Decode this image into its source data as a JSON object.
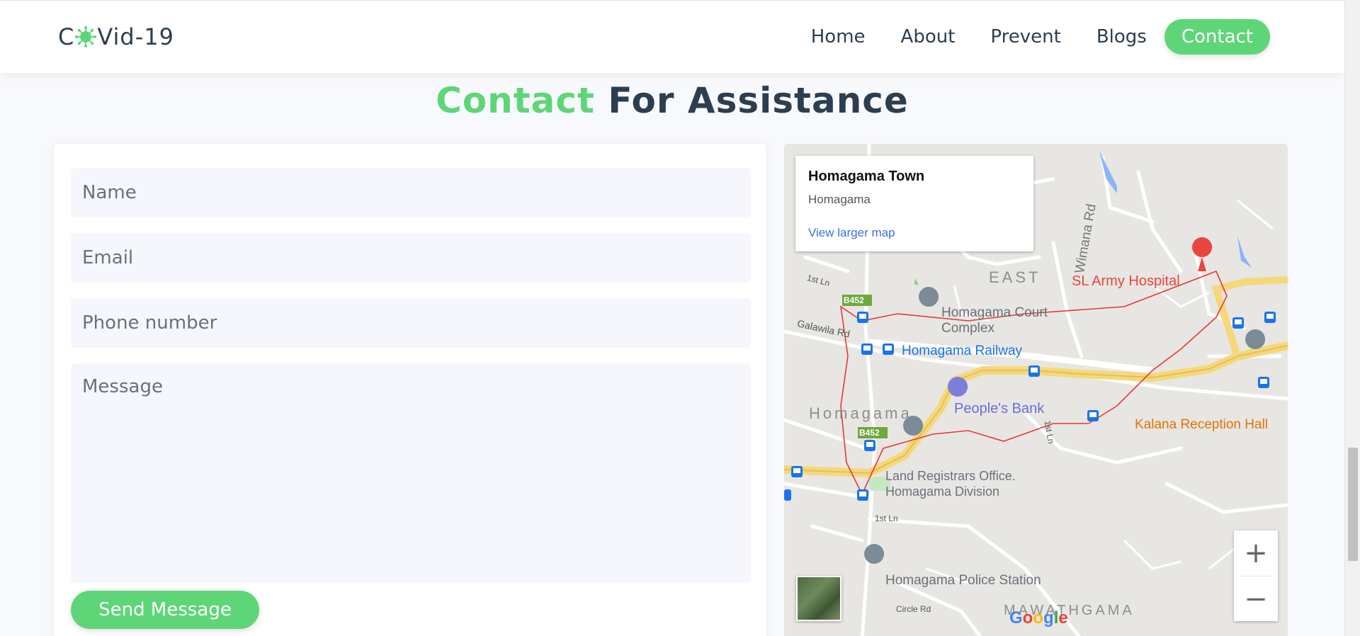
{
  "brand": {
    "prefix": "C",
    "suffix": "Vid-19"
  },
  "nav": {
    "items": [
      "Home",
      "About",
      "Prevent",
      "Blogs",
      "Contact"
    ],
    "active": "Contact"
  },
  "title": {
    "highlight": "Contact",
    "rest": "For Assistance"
  },
  "form": {
    "name_placeholder": "Name",
    "email_placeholder": "Email",
    "phone_placeholder": "Phone number",
    "message_placeholder": "Message",
    "submit_label": "Send Message"
  },
  "map": {
    "place_name": "Homagama Town",
    "place_sub": "Homagama",
    "larger_map_link": "View larger map",
    "zoom_in": "+",
    "zoom_out": "−",
    "labels": {
      "army_hospital": "SL Army Hospital",
      "court": "Homagama Court Complex",
      "railway": "Homagama Railway",
      "bank": "People's Bank",
      "town": "Homagama",
      "kalana": "Kalana Reception Hall",
      "registrars": "Land Registrars Office. Homagama Division",
      "police": "Homagama Police Station",
      "mawathgama": "MAWATHGAMA",
      "east": "EAST",
      "road_b452_a": "B452",
      "road_b452_b": "B452",
      "galawila": "Galawila Rd",
      "wimana": "Wimana Rd",
      "first_ln_a": "1st Ln",
      "first_ln_b": "1st Ln",
      "first_ln_c": "1st Ln",
      "circle_rd": "Circle Rd"
    },
    "google_letters": [
      "G",
      "o",
      "o",
      "g",
      "l",
      "e"
    ],
    "colors": {
      "boundary": "#e53935",
      "main_road": "#f6d87a",
      "poi_gray": "#7b8b98",
      "hospital": "#e8453c",
      "transit": "#1a73e8"
    }
  },
  "colors": {
    "accent": "#5ed678",
    "text": "#2c3e50"
  }
}
